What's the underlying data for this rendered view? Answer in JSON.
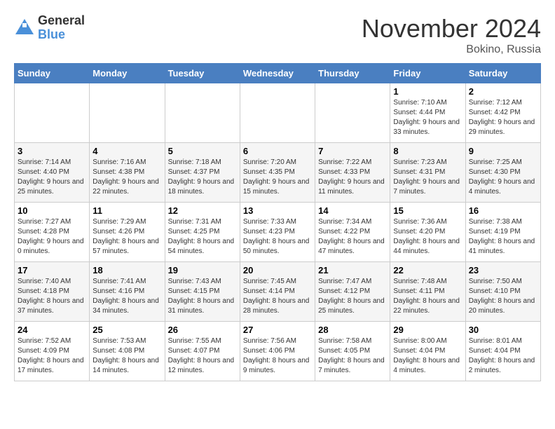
{
  "header": {
    "logo_general": "General",
    "logo_blue": "Blue",
    "month_title": "November 2024",
    "location": "Bokino, Russia"
  },
  "days_of_week": [
    "Sunday",
    "Monday",
    "Tuesday",
    "Wednesday",
    "Thursday",
    "Friday",
    "Saturday"
  ],
  "weeks": [
    [
      {
        "day": "",
        "info": ""
      },
      {
        "day": "",
        "info": ""
      },
      {
        "day": "",
        "info": ""
      },
      {
        "day": "",
        "info": ""
      },
      {
        "day": "",
        "info": ""
      },
      {
        "day": "1",
        "info": "Sunrise: 7:10 AM\nSunset: 4:44 PM\nDaylight: 9 hours and 33 minutes."
      },
      {
        "day": "2",
        "info": "Sunrise: 7:12 AM\nSunset: 4:42 PM\nDaylight: 9 hours and 29 minutes."
      }
    ],
    [
      {
        "day": "3",
        "info": "Sunrise: 7:14 AM\nSunset: 4:40 PM\nDaylight: 9 hours and 25 minutes."
      },
      {
        "day": "4",
        "info": "Sunrise: 7:16 AM\nSunset: 4:38 PM\nDaylight: 9 hours and 22 minutes."
      },
      {
        "day": "5",
        "info": "Sunrise: 7:18 AM\nSunset: 4:37 PM\nDaylight: 9 hours and 18 minutes."
      },
      {
        "day": "6",
        "info": "Sunrise: 7:20 AM\nSunset: 4:35 PM\nDaylight: 9 hours and 15 minutes."
      },
      {
        "day": "7",
        "info": "Sunrise: 7:22 AM\nSunset: 4:33 PM\nDaylight: 9 hours and 11 minutes."
      },
      {
        "day": "8",
        "info": "Sunrise: 7:23 AM\nSunset: 4:31 PM\nDaylight: 9 hours and 7 minutes."
      },
      {
        "day": "9",
        "info": "Sunrise: 7:25 AM\nSunset: 4:30 PM\nDaylight: 9 hours and 4 minutes."
      }
    ],
    [
      {
        "day": "10",
        "info": "Sunrise: 7:27 AM\nSunset: 4:28 PM\nDaylight: 9 hours and 0 minutes."
      },
      {
        "day": "11",
        "info": "Sunrise: 7:29 AM\nSunset: 4:26 PM\nDaylight: 8 hours and 57 minutes."
      },
      {
        "day": "12",
        "info": "Sunrise: 7:31 AM\nSunset: 4:25 PM\nDaylight: 8 hours and 54 minutes."
      },
      {
        "day": "13",
        "info": "Sunrise: 7:33 AM\nSunset: 4:23 PM\nDaylight: 8 hours and 50 minutes."
      },
      {
        "day": "14",
        "info": "Sunrise: 7:34 AM\nSunset: 4:22 PM\nDaylight: 8 hours and 47 minutes."
      },
      {
        "day": "15",
        "info": "Sunrise: 7:36 AM\nSunset: 4:20 PM\nDaylight: 8 hours and 44 minutes."
      },
      {
        "day": "16",
        "info": "Sunrise: 7:38 AM\nSunset: 4:19 PM\nDaylight: 8 hours and 41 minutes."
      }
    ],
    [
      {
        "day": "17",
        "info": "Sunrise: 7:40 AM\nSunset: 4:18 PM\nDaylight: 8 hours and 37 minutes."
      },
      {
        "day": "18",
        "info": "Sunrise: 7:41 AM\nSunset: 4:16 PM\nDaylight: 8 hours and 34 minutes."
      },
      {
        "day": "19",
        "info": "Sunrise: 7:43 AM\nSunset: 4:15 PM\nDaylight: 8 hours and 31 minutes."
      },
      {
        "day": "20",
        "info": "Sunrise: 7:45 AM\nSunset: 4:14 PM\nDaylight: 8 hours and 28 minutes."
      },
      {
        "day": "21",
        "info": "Sunrise: 7:47 AM\nSunset: 4:12 PM\nDaylight: 8 hours and 25 minutes."
      },
      {
        "day": "22",
        "info": "Sunrise: 7:48 AM\nSunset: 4:11 PM\nDaylight: 8 hours and 22 minutes."
      },
      {
        "day": "23",
        "info": "Sunrise: 7:50 AM\nSunset: 4:10 PM\nDaylight: 8 hours and 20 minutes."
      }
    ],
    [
      {
        "day": "24",
        "info": "Sunrise: 7:52 AM\nSunset: 4:09 PM\nDaylight: 8 hours and 17 minutes."
      },
      {
        "day": "25",
        "info": "Sunrise: 7:53 AM\nSunset: 4:08 PM\nDaylight: 8 hours and 14 minutes."
      },
      {
        "day": "26",
        "info": "Sunrise: 7:55 AM\nSunset: 4:07 PM\nDaylight: 8 hours and 12 minutes."
      },
      {
        "day": "27",
        "info": "Sunrise: 7:56 AM\nSunset: 4:06 PM\nDaylight: 8 hours and 9 minutes."
      },
      {
        "day": "28",
        "info": "Sunrise: 7:58 AM\nSunset: 4:05 PM\nDaylight: 8 hours and 7 minutes."
      },
      {
        "day": "29",
        "info": "Sunrise: 8:00 AM\nSunset: 4:04 PM\nDaylight: 8 hours and 4 minutes."
      },
      {
        "day": "30",
        "info": "Sunrise: 8:01 AM\nSunset: 4:04 PM\nDaylight: 8 hours and 2 minutes."
      }
    ]
  ]
}
